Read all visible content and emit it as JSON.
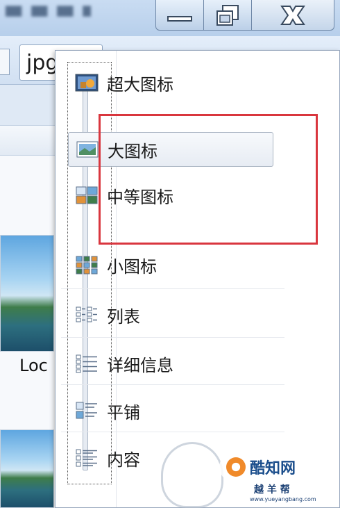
{
  "window": {
    "search_value": "jpg",
    "background_file_label": "Loc"
  },
  "view_menu": {
    "items": [
      {
        "label": "超大图标",
        "icon": "extra-large-icons-icon"
      },
      {
        "label": "大图标",
        "icon": "large-icons-icon",
        "selected": true
      },
      {
        "label": "中等图标",
        "icon": "medium-icons-icon"
      },
      {
        "label": "小图标",
        "icon": "small-icons-icon"
      },
      {
        "label": "列表",
        "icon": "list-icon"
      },
      {
        "label": "详细信息",
        "icon": "details-icon"
      },
      {
        "label": "平铺",
        "icon": "tiles-icon"
      },
      {
        "label": "内容",
        "icon": "content-icon"
      }
    ],
    "highlight_color": "#d9363e",
    "accent_color": "#3d78b6"
  },
  "watermark": {
    "brand": "酷知网",
    "sub": "越 羊 帮",
    "url": "www.yueyangbang.com"
  }
}
